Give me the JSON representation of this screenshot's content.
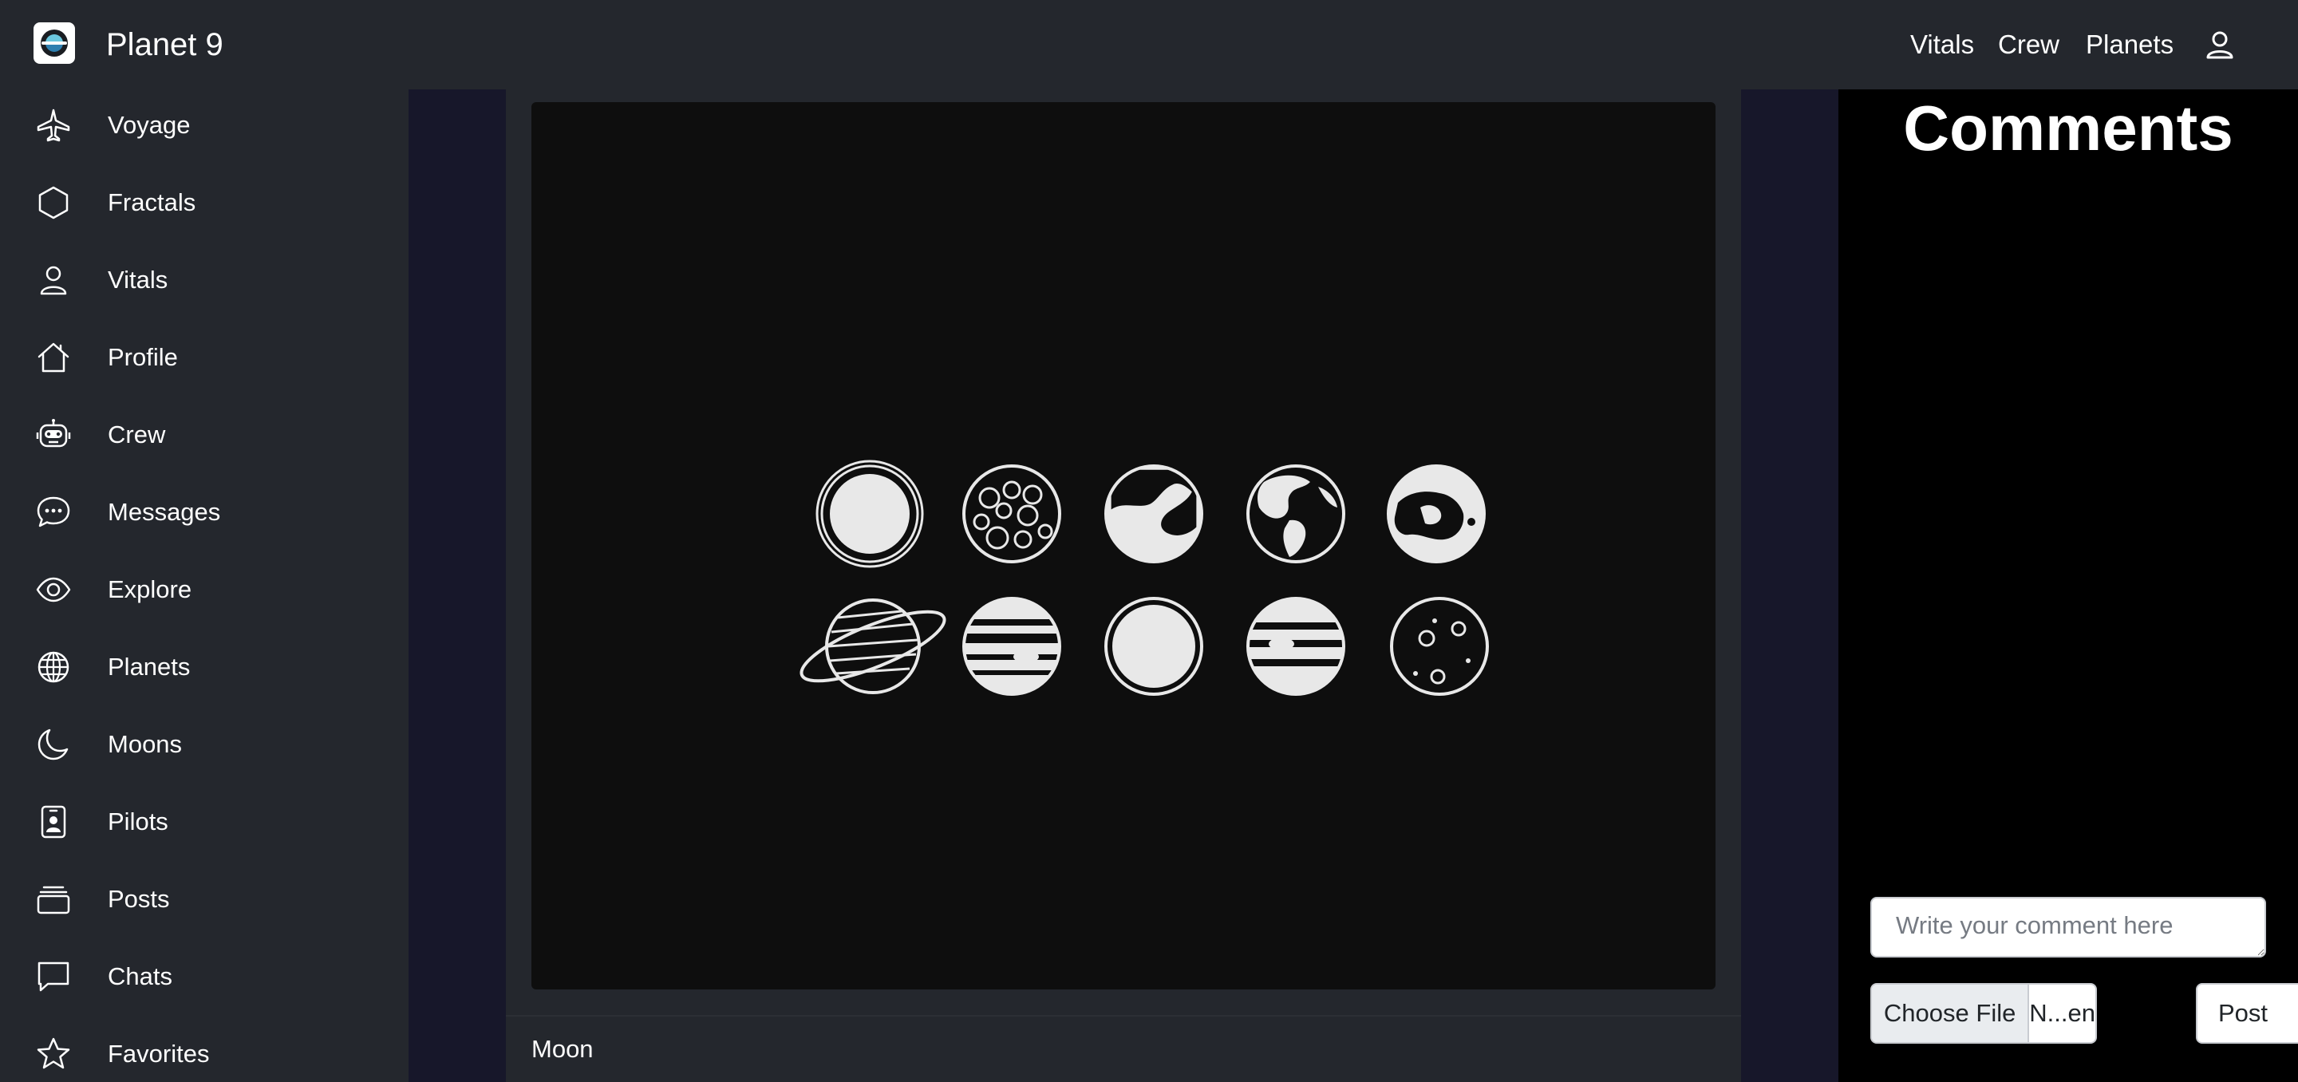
{
  "app": {
    "brand": "Planet 9"
  },
  "topnav": {
    "items": [
      {
        "label": "Vitals"
      },
      {
        "label": "Crew"
      },
      {
        "label": "Planets"
      }
    ]
  },
  "sidebar": {
    "items": [
      {
        "label": "Voyage",
        "icon": "airplane-icon"
      },
      {
        "label": "Fractals",
        "icon": "hexagon-icon"
      },
      {
        "label": "Vitals",
        "icon": "person-icon"
      },
      {
        "label": "Profile",
        "icon": "house-icon"
      },
      {
        "label": "Crew",
        "icon": "robot-icon"
      },
      {
        "label": "Messages",
        "icon": "chat-dots-icon"
      },
      {
        "label": "Explore",
        "icon": "eye-icon"
      },
      {
        "label": "Planets",
        "icon": "globe-icon"
      },
      {
        "label": "Moons",
        "icon": "moon-icon"
      },
      {
        "label": "Pilots",
        "icon": "badge-icon"
      },
      {
        "label": "Posts",
        "icon": "collection-icon"
      },
      {
        "label": "Chats",
        "icon": "chat-square-icon"
      },
      {
        "label": "Favorites",
        "icon": "star-icon"
      }
    ]
  },
  "post": {
    "caption": "Moon"
  },
  "comments": {
    "title": "Comments",
    "placeholder": "Write your comment here",
    "file_button": "Choose File",
    "file_name": "N...en",
    "post_button": "Post"
  },
  "colors": {
    "background": "#24272d",
    "gutter": "#17172a",
    "media": "#0e0e0e",
    "comments_panel": "#000000"
  }
}
